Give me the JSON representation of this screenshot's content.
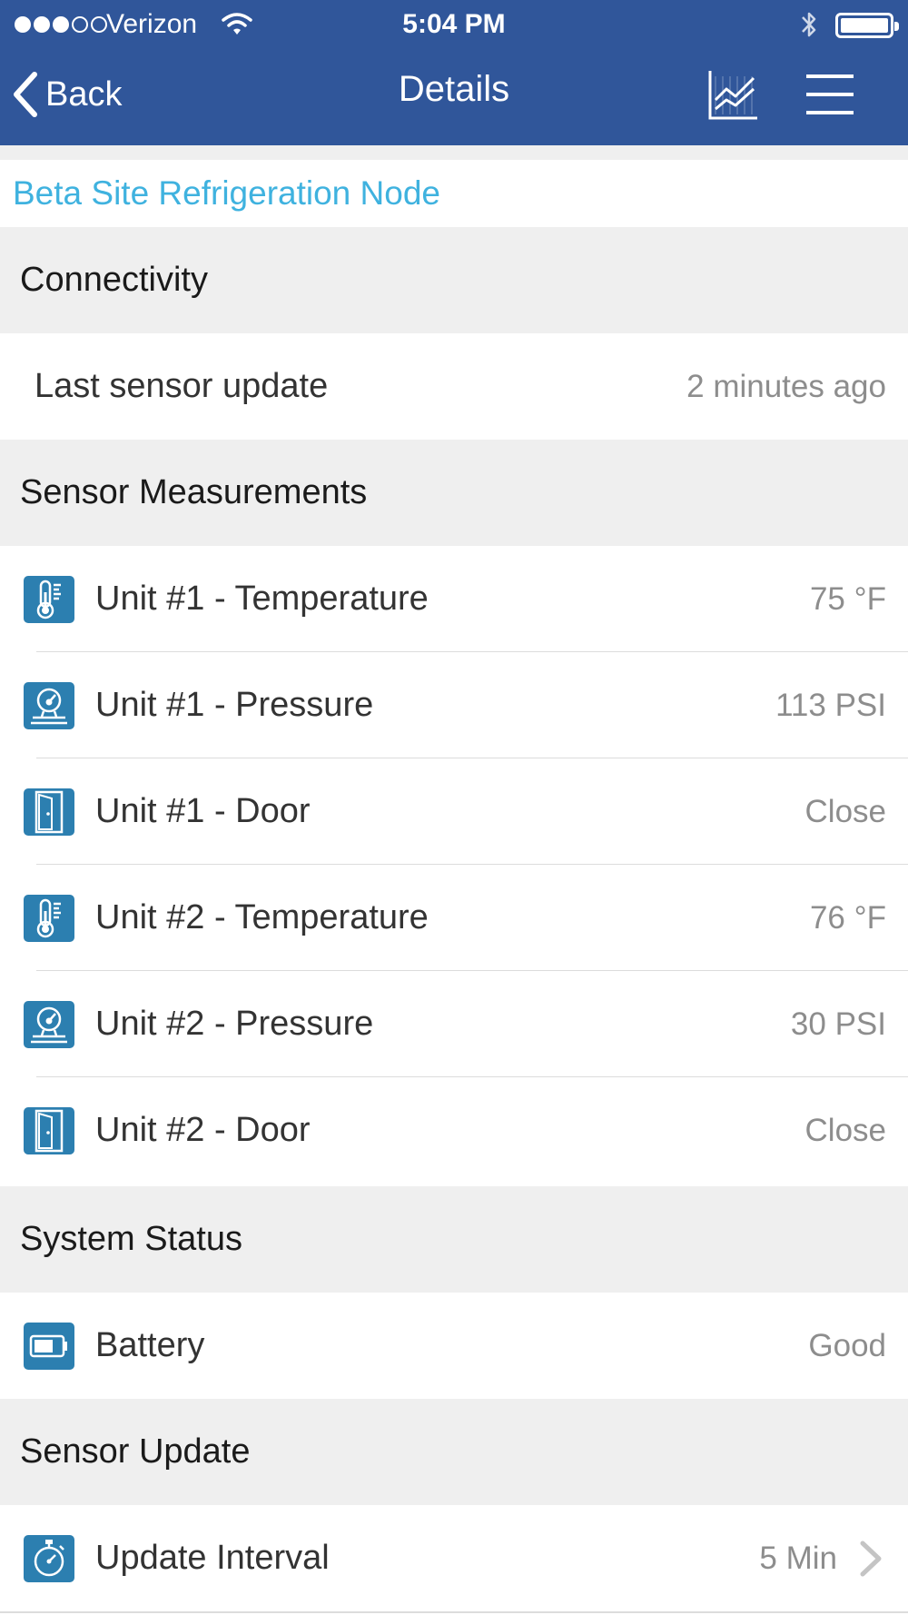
{
  "status_bar": {
    "carrier": "Verizon",
    "time": "5:04 PM",
    "signal_bars_filled": 3,
    "signal_bars_total": 5
  },
  "nav": {
    "back_label": "Back",
    "title": "Details",
    "chart_icon": "line-chart-icon",
    "menu_icon": "hamburger-menu-icon"
  },
  "site_name": "Beta Site Refrigeration Node",
  "sections": {
    "connectivity": {
      "title": "Connectivity",
      "rows": [
        {
          "label": "Last sensor update",
          "value": "2 minutes ago"
        }
      ]
    },
    "sensor_measurements": {
      "title": "Sensor Measurements",
      "rows": [
        {
          "icon": "thermometer-icon",
          "label": "Unit #1 - Temperature",
          "value": "75 °F"
        },
        {
          "icon": "pressure-gauge-icon",
          "label": "Unit #1 - Pressure",
          "value": "113 PSI"
        },
        {
          "icon": "door-icon",
          "label": "Unit #1 - Door",
          "value": "Close"
        },
        {
          "icon": "thermometer-icon",
          "label": "Unit #2 - Temperature",
          "value": "76 °F"
        },
        {
          "icon": "pressure-gauge-icon",
          "label": "Unit #2 - Pressure",
          "value": "30 PSI"
        },
        {
          "icon": "door-icon",
          "label": "Unit #2 - Door",
          "value": "Close"
        }
      ]
    },
    "system_status": {
      "title": "System Status",
      "rows": [
        {
          "icon": "battery-icon",
          "label": "Battery",
          "value": "Good"
        }
      ]
    },
    "sensor_update": {
      "title": "Sensor Update",
      "rows": [
        {
          "icon": "stopwatch-icon",
          "label": "Update Interval",
          "value": "5 Min"
        }
      ]
    }
  },
  "colors": {
    "nav_background": "#30569a",
    "site_name": "#3fb2df",
    "icon_tile": "#2c7fb0",
    "section_background": "#efefef",
    "value_text": "#8d8d8d"
  }
}
